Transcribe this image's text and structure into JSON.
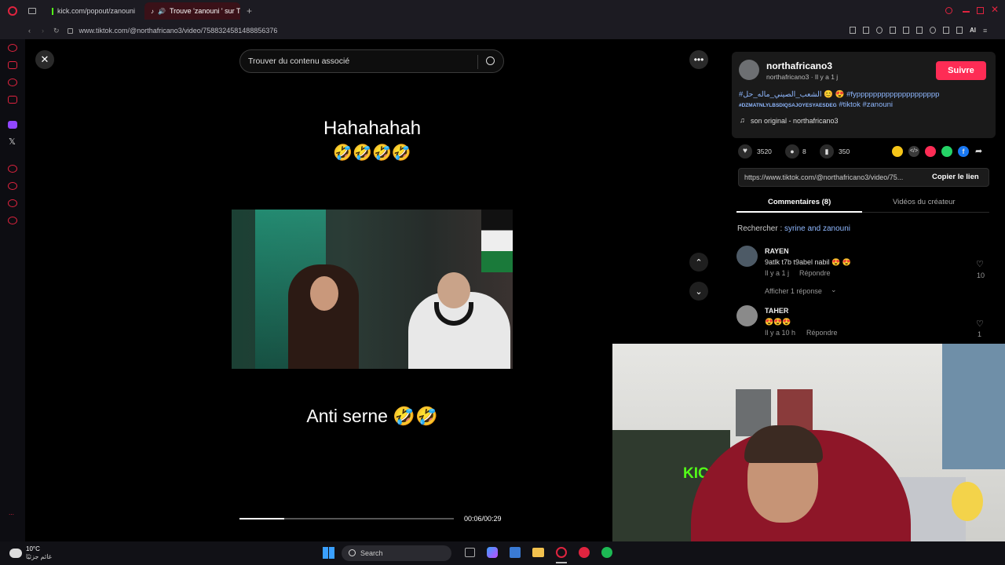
{
  "browser": {
    "tabs": [
      {
        "label": "kick.com/popout/zanouni"
      },
      {
        "label": "Trouve 'zanouni ' sur T"
      }
    ],
    "url": "www.tiktok.com/@northafricano3/video/7588324581488856376",
    "ai_label": "AI"
  },
  "search": {
    "placeholder": "Trouver du contenu associé"
  },
  "video": {
    "top_caption": "Hahahahah",
    "top_emojis": "🤣🤣🤣🤣",
    "bottom_caption": "Anti serne 🤣🤣",
    "time": "00:06/00:29",
    "progress": 0.21
  },
  "author": {
    "name": "northafricano3",
    "sub": "northafricano3 · Il y a 1 j",
    "follow": "Suivre"
  },
  "post": {
    "hashtags_line1": "#الشعب_الصيني_ماله_حل 😊 😍 #fypppppppppppppppppppp",
    "hashtags_line2_small": "#DZMATNLYLBSDIQSAJOYESYAESDEG",
    "hashtags_line2_rest": "#tiktok #zanouni",
    "sound": "son original - northafricano3"
  },
  "stats": {
    "likes": "3520",
    "comments": "8",
    "saves": "350"
  },
  "link": {
    "url": "https://www.tiktok.com/@northafricano3/video/75...",
    "copy": "Copier le lien"
  },
  "tabs": {
    "comments": "Commentaires (8)",
    "creator": "Vidéos du créateur"
  },
  "search_hint": {
    "prefix": "Rechercher :",
    "query": "syrine and zanouni"
  },
  "comments": [
    {
      "name": "RAYEN",
      "text": "9atlk t7b t9abel nabil 😍 😍",
      "time": "Il y a 1 j",
      "reply": "Répondre",
      "likes": "10",
      "more": "Afficher 1 réponse"
    },
    {
      "name": "TAHER",
      "text": "😍😍😍",
      "time": "Il y a 10 h",
      "reply": "Répondre",
      "likes": "1"
    }
  ],
  "taskbar": {
    "weather_temp": "10°C",
    "weather_text": "غائم جزئيًا",
    "search": "Search"
  },
  "colors": {
    "accent": "#fe2c55",
    "link": "#8fb8ff"
  }
}
